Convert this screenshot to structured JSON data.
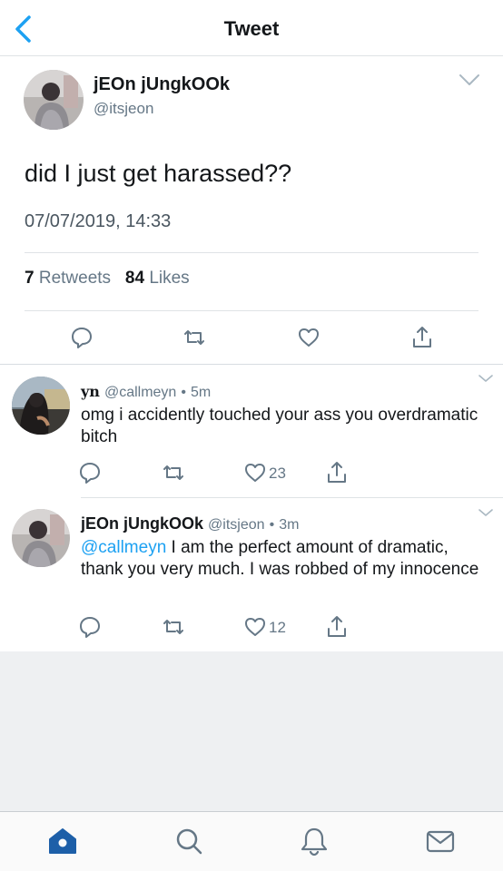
{
  "header": {
    "title": "Tweet",
    "back_icon": "chevron-left-icon",
    "accent": "#1da1f2"
  },
  "main_tweet": {
    "display_name": "jEOn jUngkOOk",
    "handle": "@itsjeon",
    "text": "did I just get harassed??",
    "timestamp": "07/07/2019, 14:33",
    "retweets_count": "7",
    "retweets_label": "Retweets",
    "likes_count": "84",
    "likes_label": "Likes",
    "actions": [
      "reply-icon",
      "retweet-icon",
      "like-icon",
      "share-icon"
    ]
  },
  "replies": [
    {
      "display_name": "yn",
      "handle": "@callmeyn",
      "separator": "•",
      "time_ago": "5m",
      "text": "omg i accidently touched your ass you overdramatic bitch",
      "likes": "23"
    },
    {
      "display_name": "jEOn jUngkOOk",
      "handle": "@itsjeon",
      "separator": "•",
      "time_ago": "3m",
      "mention": "@callmeyn",
      "text": " I am the perfect amount of dramatic, thank you very much. I was robbed of my innocence",
      "likes": "12"
    }
  ],
  "tabbar": {
    "items": [
      "home-icon",
      "search-icon",
      "notifications-icon",
      "messages-icon"
    ],
    "active_color": "#1d5fa8"
  }
}
